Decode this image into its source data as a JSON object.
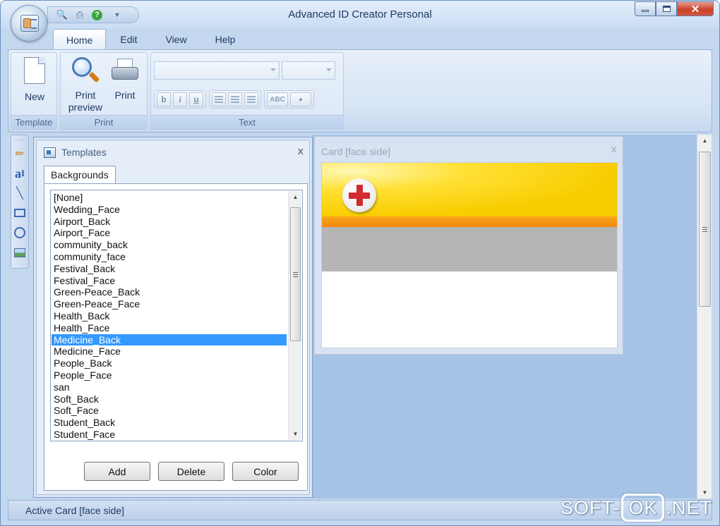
{
  "window": {
    "title": "Advanced ID Creator Personal"
  },
  "quick_access": {
    "icons": [
      "find-icon",
      "printer-icon",
      "help-icon",
      "customize-chevron-icon"
    ],
    "help_glyph": "?"
  },
  "ribbon": {
    "tabs": [
      {
        "label": "Home",
        "active": true
      },
      {
        "label": "Edit",
        "active": false
      },
      {
        "label": "View",
        "active": false
      },
      {
        "label": "Help",
        "active": false
      }
    ],
    "groups": {
      "template": {
        "label": "Template",
        "new_label": "New"
      },
      "print": {
        "label": "Print",
        "preview_label": "Print preview",
        "print_label": "Print"
      },
      "text": {
        "label": "Text",
        "font_value": "",
        "size_value": "",
        "bold": "b",
        "italic": "i",
        "underline": "u",
        "abc": "ABC"
      }
    }
  },
  "toolbox": {
    "tools": [
      "brush-icon",
      "text-tool-icon",
      "line-icon",
      "rectangle-icon",
      "ellipse-icon",
      "image-icon"
    ],
    "text_glyph": "a",
    "text_cursor": "I"
  },
  "templates_panel": {
    "title": "Templates",
    "close": "x",
    "tab": "Backgrounds",
    "items": [
      "[None]",
      "Wedding_Face",
      "Airport_Back",
      "Airport_Face",
      "community_back",
      "community_face",
      "Festival_Back",
      "Festival_Face",
      "Green-Peace_Back",
      "Green-Peace_Face",
      "Health_Back",
      "Health_Face",
      "Medicine_Back",
      "Medicine_Face",
      "People_Back",
      "People_Face",
      "san",
      "Soft_Back",
      "Soft_Face",
      "Student_Back",
      "Student_Face"
    ],
    "selected": "Medicine_Back",
    "buttons": {
      "add": "Add",
      "delete": "Delete",
      "color": "Color"
    }
  },
  "card_panel": {
    "title": "Card [face side]",
    "close": "x"
  },
  "status": {
    "text": "Active Card [face side]"
  },
  "watermark": {
    "prefix": "SOFT-",
    "boxed": "OK",
    "suffix": ".NET"
  },
  "colors": {
    "accent": "#3399ff",
    "card_yellow": "#f8cd00",
    "card_orange": "#f2870d",
    "card_gray": "#b5b5b5",
    "cross_red": "#d22a2f"
  }
}
